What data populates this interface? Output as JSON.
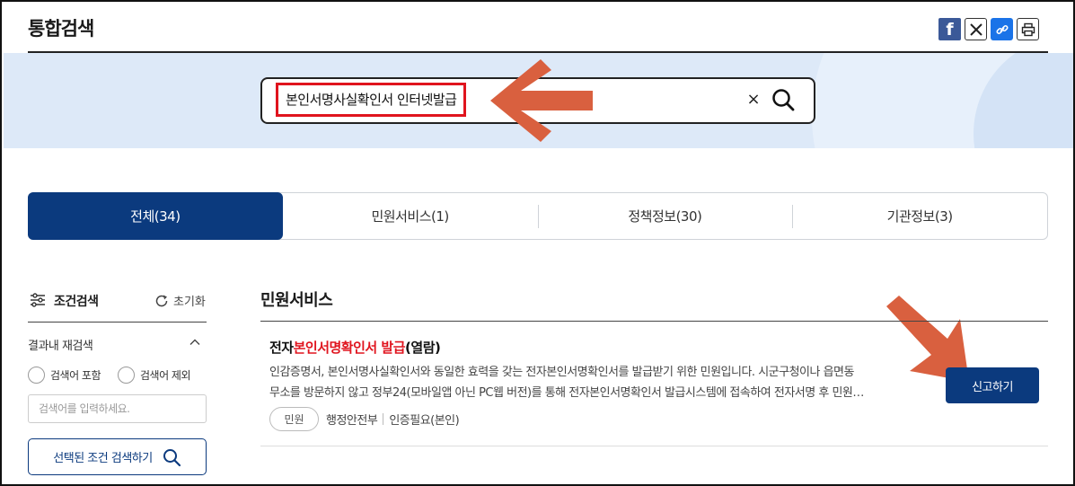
{
  "header": {
    "title": "통합검색",
    "share": {
      "facebook_icon": "facebook-icon",
      "x_icon": "x-icon",
      "link_icon": "link-icon",
      "print_icon": "print-icon"
    }
  },
  "search": {
    "value": "본인서명사실확인서 인터넷발급",
    "clear_label": "×"
  },
  "tabs": [
    {
      "label": "전체(34)",
      "active": true
    },
    {
      "label": "민원서비스(1)",
      "active": false
    },
    {
      "label": "정책정보(30)",
      "active": false
    },
    {
      "label": "기관정보(3)",
      "active": false
    }
  ],
  "sidebar": {
    "title": "조건검색",
    "reset_label": "초기화",
    "refine_label": "결과내 재검색",
    "include_label": "검색어 포함",
    "exclude_label": "검색어 제외",
    "keyword_placeholder": "검색어를 입력하세요.",
    "apply_label": "선택된 조건 검색하기"
  },
  "results": {
    "section_title": "민원서비스",
    "items": [
      {
        "title_prefix": "전자",
        "title_highlight": "본인서명확인서 발급",
        "title_suffix": "(열람)",
        "desc_line1": "인감증명서, 본인서명사실확인서와 동일한 효력을 갖는 전자본인서명확인서를 발급받기 위한 민원입니다. 시군구청이나 읍면동",
        "desc_line2": "무소를 방문하지 않고 정부24(모바일앱 아닌 PC웹 버전)를 통해 전자본인서명확인서 발급시스템에 접속하여 전자서명 후 민원…",
        "category": "민원",
        "agency": "행정안전부",
        "auth": "인증필요(본인)",
        "action_label": "신고하기"
      }
    ]
  },
  "colors": {
    "primary": "#0b3a7e",
    "highlight": "#e0141e",
    "annotation": "#d9603f",
    "band": "#dde9f8"
  }
}
